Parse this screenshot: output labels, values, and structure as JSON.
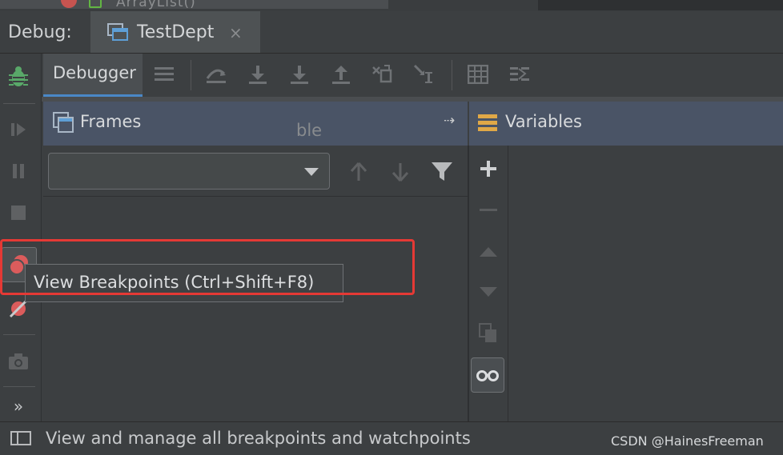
{
  "top_strip": {
    "ghost_text": "ArrayList()"
  },
  "debug_bar": {
    "label": "Debug:",
    "tab_title": "TestDept",
    "tab_close": "×"
  },
  "toolbar": {
    "debugger_tab": "Debugger"
  },
  "frames": {
    "title": "Frames",
    "pin": "⇢",
    "empty_text": "ble"
  },
  "variables": {
    "title": "Variables"
  },
  "tooltip": {
    "text": "View Breakpoints (Ctrl+Shift+F8)"
  },
  "sidebar": {
    "more": "»"
  },
  "status_bar": {
    "text": "View and manage all breakpoints and watchpoints",
    "watermark": "CSDN @HainesFreeman"
  },
  "colors": {
    "accent": "#4a88c7",
    "header": "#4a5466",
    "highlight": "#e53935",
    "bug_green": "#59a869",
    "breakpoint_red": "#db5c5c"
  }
}
